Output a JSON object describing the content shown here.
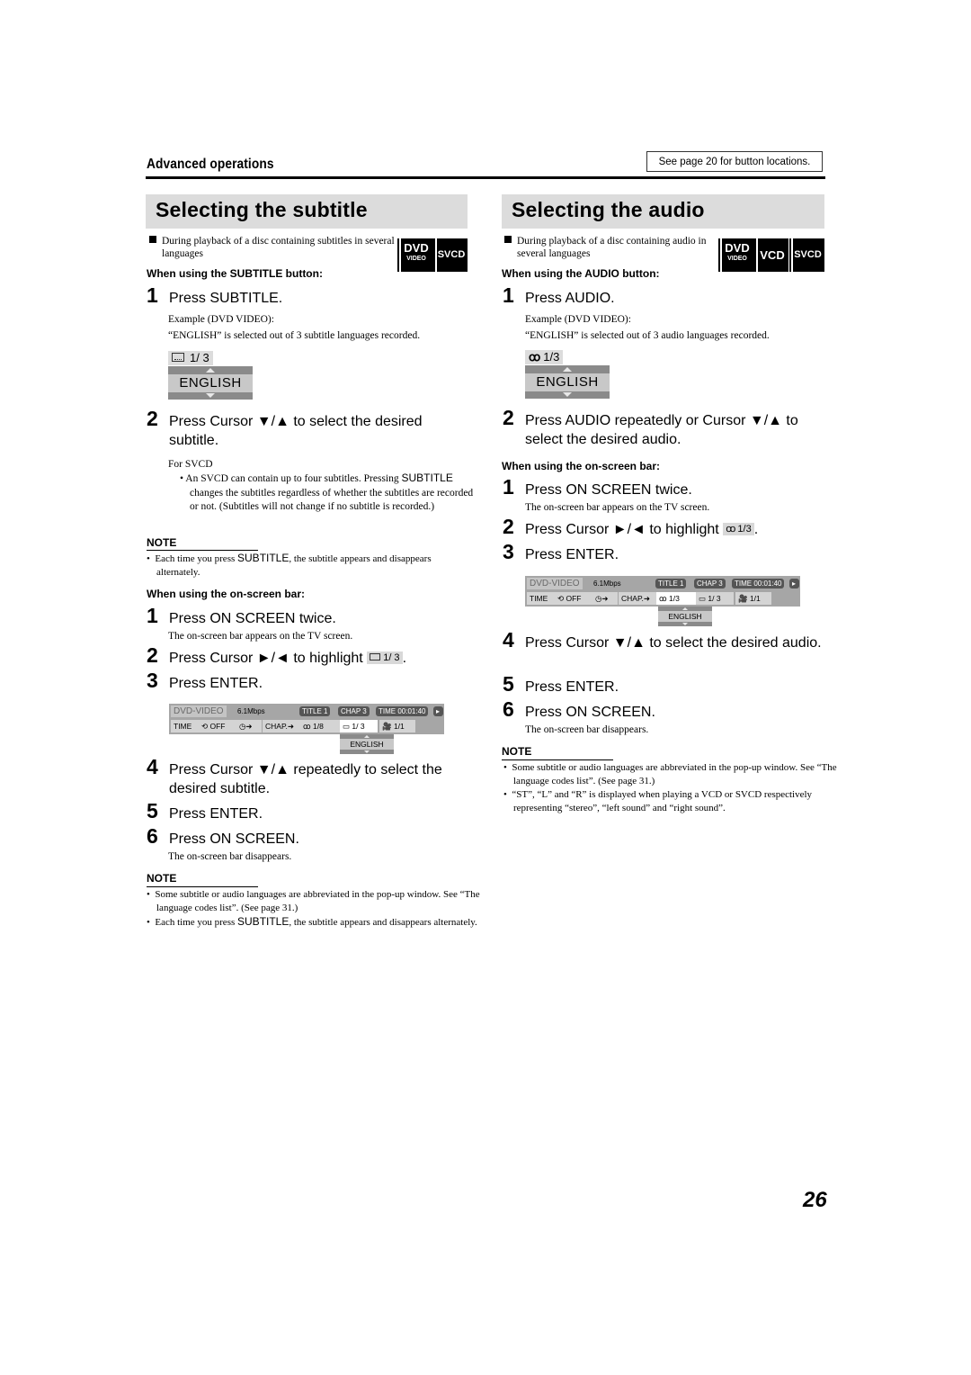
{
  "header": {
    "section": "Advanced operations",
    "see_page": "See page 20 for button locations."
  },
  "subtitle": {
    "title": "Selecting the subtitle",
    "intro": "During playback of a disc containing subtitles in several languages",
    "badges": [
      {
        "big": "DVD",
        "small": "VIDEO"
      },
      {
        "big": "SVCD",
        "small": ""
      }
    ],
    "button_label": "When using the SUBTITLE button:",
    "button_steps": [
      {
        "num": "1",
        "text": "Press SUBTITLE."
      },
      {
        "num": "2",
        "text": "Press Cursor ▼/▲ to select the desired subtitle."
      }
    ],
    "example_heading": "Example (DVD VIDEO):",
    "example_text": "“ENGLISH” is selected out of 3 subtitle languages recorded.",
    "osd": {
      "icon": "subtitle-icon",
      "counter": "1/ 3",
      "language": "ENGLISH"
    },
    "svcd_heading": "For SVCD",
    "svcd_bullet_pre": "An SVCD can contain up to four subtitles. Pressing ",
    "svcd_bullet_key": "SUBTITLE",
    "svcd_bullet_post": " changes the subtitles regardless of whether the subtitles are recorded or not. (Subtitles will not change if no subtitle is recorded.)",
    "note1": {
      "heading": "NOTE",
      "pre": "Each time you press ",
      "key": "SUBTITLE",
      "post": ", the subtitle appears and disappears alternately."
    },
    "onscreen_label": "When using the on-screen bar:",
    "onscreen_steps": [
      {
        "num": "1",
        "text": "Press ON SCREEN twice.",
        "sub": "The on-screen bar appears on the TV screen."
      },
      {
        "num": "2",
        "text": "Press Cursor ►/◄ to highlight",
        "chip": "1/ 3",
        "suffix": "."
      },
      {
        "num": "3",
        "text": "Press ENTER."
      },
      {
        "num": "4",
        "text": "Press Cursor ▼/▲ repeatedly to select the desired subtitle."
      },
      {
        "num": "5",
        "text": "Press ENTER."
      },
      {
        "num": "6",
        "text": "Press ON SCREEN.",
        "sub": "The on-screen bar disappears."
      }
    ],
    "osb": {
      "disc": "DVD-VIDEO",
      "rate": "6.1Mbps",
      "title": "TITLE  1",
      "chap": "CHAP  3",
      "time": "TIME 00:01:40",
      "cells": [
        "TIME",
        "OFF",
        "CHAP.",
        "1/8",
        "1/ 3",
        "1/1"
      ],
      "popup": "ENGLISH"
    },
    "note2": {
      "heading": "NOTE",
      "items": [
        {
          "pre": "Some subtitle or audio languages are abbreviated in the pop-up window. See “The language codes list”. (See page 31.)"
        },
        {
          "pre": "Each time you press ",
          "key": "SUBTITLE",
          "post": ", the subtitle appears and disappears alternately."
        }
      ]
    }
  },
  "audio": {
    "title": "Selecting the audio",
    "intro": "During playback of a disc containing audio in several languages",
    "badges": [
      {
        "big": "DVD",
        "small": "VIDEO"
      },
      {
        "big": "VCD",
        "small": ""
      },
      {
        "big": "SVCD",
        "small": ""
      }
    ],
    "button_label": "When using the AUDIO button:",
    "button_steps": [
      {
        "num": "1",
        "text": "Press AUDIO."
      },
      {
        "num": "2",
        "text": "Press AUDIO repeatedly or Cursor ▼/▲ to select the desired audio."
      }
    ],
    "example_heading": "Example (DVD VIDEO):",
    "example_text": "“ENGLISH” is selected out of 3 audio languages recorded.",
    "osd": {
      "icon": "audio-icon",
      "counter": "1/3",
      "language": "ENGLISH"
    },
    "onscreen_label": "When using the on-screen bar:",
    "onscreen_steps": [
      {
        "num": "1",
        "text": "Press ON SCREEN twice.",
        "sub": "The on-screen bar appears on the TV screen."
      },
      {
        "num": "2",
        "text": "Press Cursor ►/◄ to highlight",
        "chip": "1/3",
        "suffix": "."
      },
      {
        "num": "3",
        "text": "Press ENTER."
      },
      {
        "num": "4",
        "text": "Press Cursor ▼/▲ to select the desired audio."
      },
      {
        "num": "5",
        "text": "Press ENTER."
      },
      {
        "num": "6",
        "text": "Press ON SCREEN.",
        "sub": "The on-screen bar disappears."
      }
    ],
    "osb": {
      "disc": "DVD-VIDEO",
      "rate": "6.1Mbps",
      "title": "TITLE  1",
      "chap": "CHAP  3",
      "time": "TIME 00:01:40",
      "cells": [
        "TIME",
        "OFF",
        "CHAP.",
        "1/3",
        "1/ 3",
        "1/1"
      ],
      "popup": "ENGLISH"
    },
    "note": {
      "heading": "NOTE",
      "items": [
        "Some subtitle or audio languages are abbreviated in the pop-up window. See “The language codes list”. (See page 31.)",
        "“ST”, “L” and “R” is displayed when playing a VCD or SVCD respectively representing “stereo”, “left sound” and “right sound”."
      ]
    }
  },
  "page_number": "26"
}
